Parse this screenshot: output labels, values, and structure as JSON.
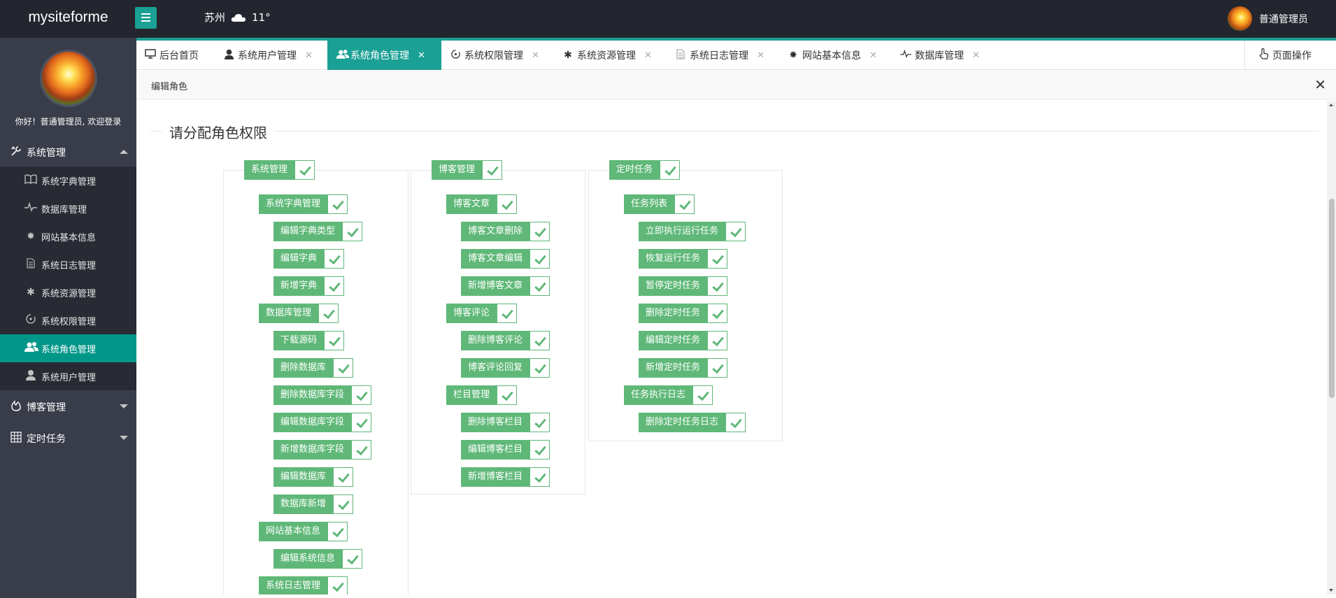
{
  "app": {
    "logo": "mysiteforme",
    "weather_city": "苏州",
    "weather_temp": "11°",
    "user_name": "普通管理员",
    "welcome": "你好！普通管理员, 欢迎登录"
  },
  "sidebar": {
    "groups": [
      {
        "label": "系统管理",
        "icon": "tools-icon",
        "expanded": true
      },
      {
        "label": "博客管理",
        "icon": "fire-icon",
        "expanded": false
      },
      {
        "label": "定时任务",
        "icon": "grid-icon",
        "expanded": false
      }
    ],
    "sys_items": [
      {
        "label": "系统字典管理",
        "icon": "book-icon"
      },
      {
        "label": "数据库管理",
        "icon": "pulse-icon"
      },
      {
        "label": "网站基本信息",
        "icon": "gear-icon"
      },
      {
        "label": "系统日志管理",
        "icon": "document-icon"
      },
      {
        "label": "系统资源管理",
        "icon": "palm-icon"
      },
      {
        "label": "系统权限管理",
        "icon": "dial-icon"
      },
      {
        "label": "系统角色管理",
        "icon": "users-icon",
        "active": true
      },
      {
        "label": "系统用户管理",
        "icon": "user-icon"
      }
    ]
  },
  "tabs": [
    {
      "label": "后台首页",
      "icon": "monitor-icon",
      "closable": false
    },
    {
      "label": "系统用户管理",
      "icon": "user-icon",
      "closable": true
    },
    {
      "label": "系统角色管理",
      "icon": "users-icon",
      "closable": true,
      "active": true
    },
    {
      "label": "系统权限管理",
      "icon": "dial-icon",
      "closable": true
    },
    {
      "label": "系统资源管理",
      "icon": "palm-icon",
      "closable": true
    },
    {
      "label": "系统日志管理",
      "icon": "document-icon",
      "closable": true
    },
    {
      "label": "网站基本信息",
      "icon": "gear-icon",
      "closable": true
    },
    {
      "label": "数据库管理",
      "icon": "pulse-icon",
      "closable": true
    }
  ],
  "page_op": "页面操作",
  "panel": {
    "title": "编辑角色",
    "legend": "请分配角色权限"
  },
  "permissions": {
    "col1": {
      "root": "系统管理",
      "nodes": [
        {
          "label": "系统字典管理",
          "level": 1
        },
        {
          "label": "编辑字典类型",
          "level": 2
        },
        {
          "label": "编辑字典",
          "level": 2
        },
        {
          "label": "新增字典",
          "level": 2
        },
        {
          "label": "数据库管理",
          "level": 1
        },
        {
          "label": "下载源码",
          "level": 2
        },
        {
          "label": "删除数据库",
          "level": 2
        },
        {
          "label": "删除数据库字段",
          "level": 2
        },
        {
          "label": "编辑数据库字段",
          "level": 2
        },
        {
          "label": "新增数据库字段",
          "level": 2
        },
        {
          "label": "编辑数据库",
          "level": 2
        },
        {
          "label": "数据库新增",
          "level": 2
        },
        {
          "label": "网站基本信息",
          "level": 1
        },
        {
          "label": "编辑系统信息",
          "level": 2
        },
        {
          "label": "系统日志管理",
          "level": 1
        }
      ]
    },
    "col2": {
      "root": "博客管理",
      "nodes": [
        {
          "label": "博客文章",
          "level": 1
        },
        {
          "label": "博客文章删除",
          "level": 2
        },
        {
          "label": "博客文章编辑",
          "level": 2
        },
        {
          "label": "新增博客文章",
          "level": 2
        },
        {
          "label": "博客评论",
          "level": 1
        },
        {
          "label": "删除博客评论",
          "level": 2
        },
        {
          "label": "博客评论回复",
          "level": 2
        },
        {
          "label": "栏目管理",
          "level": 1
        },
        {
          "label": "删除博客栏目",
          "level": 2
        },
        {
          "label": "编辑博客栏目",
          "level": 2
        },
        {
          "label": "新增博客栏目",
          "level": 2
        }
      ]
    },
    "col3": {
      "root": "定时任务",
      "nodes": [
        {
          "label": "任务列表",
          "level": 1
        },
        {
          "label": "立即执行运行任务",
          "level": 2
        },
        {
          "label": "恢复运行任务",
          "level": 2
        },
        {
          "label": "暂停定时任务",
          "level": 2
        },
        {
          "label": "删除定时任务",
          "level": 2
        },
        {
          "label": "编辑定时任务",
          "level": 2
        },
        {
          "label": "新增定时任务",
          "level": 2
        },
        {
          "label": "任务执行日志",
          "level": 1
        },
        {
          "label": "删除定时任务日志",
          "level": 2
        }
      ]
    }
  },
  "colors": {
    "header_bg": "#23262e",
    "sidebar_bg": "#393d49",
    "accent": "#1aa094",
    "perm_green": "#5fb878"
  }
}
